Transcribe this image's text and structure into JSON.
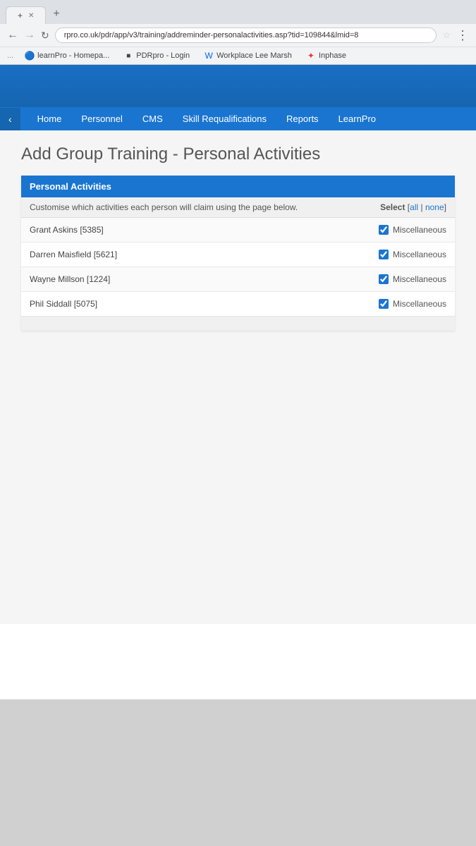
{
  "browser": {
    "tab_label": "+",
    "new_tab_icon": "+",
    "address_bar_url": "rpro.co.uk/pdr/app/v3/training/addreminder-personalactivities.asp?tid=109844&lmid=8",
    "bookmarks": [
      {
        "id": "learnpro-home",
        "label": "learnPro - Homepa...",
        "icon_color": "#1a73e8"
      },
      {
        "id": "pdrpro-login",
        "label": "PDRpro - Login",
        "icon_color": "#333"
      },
      {
        "id": "workplace-lee",
        "label": "Workplace Lee Marsh",
        "icon_color": "#0866ff"
      },
      {
        "id": "inphase",
        "label": "Inphase",
        "icon_color": "#e53935"
      }
    ]
  },
  "nav": {
    "back_label": "‹",
    "items": [
      {
        "id": "home",
        "label": "Home"
      },
      {
        "id": "personnel",
        "label": "Personnel"
      },
      {
        "id": "cms",
        "label": "CMS"
      },
      {
        "id": "skill-requalifications",
        "label": "Skill Requalifications"
      },
      {
        "id": "reports",
        "label": "Reports"
      },
      {
        "id": "learnpro",
        "label": "LearnPro"
      }
    ]
  },
  "page": {
    "title": "Add Group Training - Personal Activities",
    "table": {
      "header": "Personal Activities",
      "description": "Customise which activities each person will claim using the page below.",
      "select_label": "Select",
      "select_all": "all",
      "select_none": "none",
      "persons": [
        {
          "id": "person-1",
          "name": "Grant Askins [5385]",
          "checked": true,
          "activity": "Miscellaneous"
        },
        {
          "id": "person-2",
          "name": "Darren Maisfield [5621]",
          "checked": true,
          "activity": "Miscellaneous"
        },
        {
          "id": "person-3",
          "name": "Wayne Millson [1224]",
          "checked": true,
          "activity": "Miscellaneous"
        },
        {
          "id": "person-4",
          "name": "Phil Siddall [5075]",
          "checked": true,
          "activity": "Miscellaneous"
        }
      ]
    }
  },
  "colors": {
    "primary_blue": "#1a75d1",
    "nav_blue": "#1565b0"
  }
}
